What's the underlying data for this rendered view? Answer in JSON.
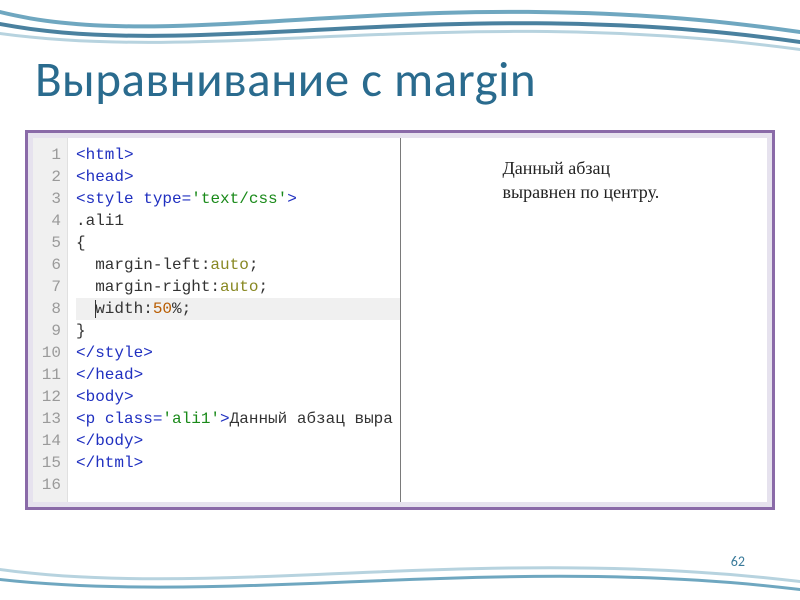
{
  "title": "Выравнивание с margin",
  "page_number": "62",
  "preview": {
    "line1": "Данный абзац",
    "line2": "выравнен по центру."
  },
  "code": {
    "lines": [
      {
        "n": "1",
        "tokens": [
          {
            "t": "<html>",
            "c": "tag"
          }
        ]
      },
      {
        "n": "2",
        "tokens": [
          {
            "t": "<head>",
            "c": "tag"
          }
        ]
      },
      {
        "n": "3",
        "tokens": [
          {
            "t": "<style ",
            "c": "tag"
          },
          {
            "t": "type=",
            "c": "attr"
          },
          {
            "t": "'text/css'",
            "c": "str"
          },
          {
            "t": ">",
            "c": "tag"
          }
        ]
      },
      {
        "n": "4",
        "tokens": [
          {
            "t": ".ali1",
            "c": "sel"
          }
        ]
      },
      {
        "n": "5",
        "tokens": [
          {
            "t": "{",
            "c": "sel"
          }
        ]
      },
      {
        "n": "6",
        "tokens": [
          {
            "t": "  margin-left:",
            "c": "prop"
          },
          {
            "t": "auto",
            "c": "kw"
          },
          {
            "t": ";",
            "c": "prop"
          }
        ]
      },
      {
        "n": "7",
        "tokens": [
          {
            "t": "  margin-right:",
            "c": "prop"
          },
          {
            "t": "auto",
            "c": "kw"
          },
          {
            "t": ";",
            "c": "prop"
          }
        ]
      },
      {
        "n": "8",
        "hl": true,
        "cursor_before": 2,
        "tokens": [
          {
            "t": "  ",
            "c": "prop"
          },
          {
            "t": "width:",
            "c": "prop"
          },
          {
            "t": "50",
            "c": "num"
          },
          {
            "t": "%;",
            "c": "prop"
          }
        ]
      },
      {
        "n": "9",
        "tokens": [
          {
            "t": "}",
            "c": "sel"
          }
        ]
      },
      {
        "n": "10",
        "tokens": [
          {
            "t": "</style>",
            "c": "tag"
          }
        ]
      },
      {
        "n": "11",
        "tokens": [
          {
            "t": "</head>",
            "c": "tag"
          }
        ]
      },
      {
        "n": "12",
        "tokens": [
          {
            "t": "<body>",
            "c": "tag"
          }
        ]
      },
      {
        "n": "13",
        "tokens": [
          {
            "t": "<p ",
            "c": "tag"
          },
          {
            "t": "class=",
            "c": "attr"
          },
          {
            "t": "'ali1'",
            "c": "str"
          },
          {
            "t": ">",
            "c": "tag"
          },
          {
            "t": "Данный абзац выра",
            "c": "sel"
          }
        ]
      },
      {
        "n": "14",
        "tokens": [
          {
            "t": "</body>",
            "c": "tag"
          }
        ]
      },
      {
        "n": "15",
        "tokens": [
          {
            "t": "</html>",
            "c": "tag"
          }
        ]
      },
      {
        "n": "16",
        "tokens": []
      }
    ]
  }
}
